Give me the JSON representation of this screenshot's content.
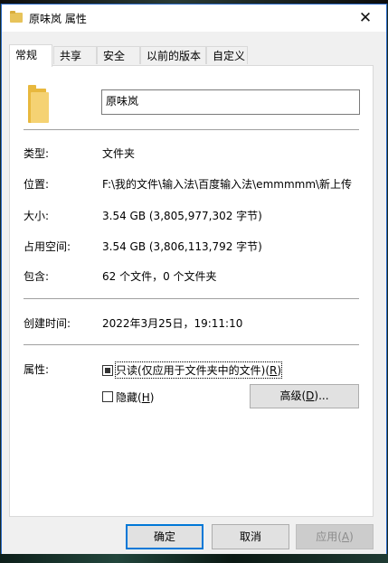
{
  "window": {
    "title": "原味岚 属性",
    "close_glyph": "✕"
  },
  "tabs": [
    "常规",
    "共享",
    "安全",
    "以前的版本",
    "自定义"
  ],
  "active_tab": "常规",
  "general": {
    "name_value": "原味岚",
    "rows": [
      {
        "label": "类型:",
        "value": "文件夹"
      },
      {
        "label": "位置:",
        "value": "F:\\我的文件\\输入法\\百度输入法\\emmmmm\\新上传"
      },
      {
        "label": "大小:",
        "value": "3.54 GB (3,805,977,302 字节)"
      },
      {
        "label": "占用空间:",
        "value": "3.54 GB (3,806,113,792 字节)"
      },
      {
        "label": "包含:",
        "value": "62 个文件，0 个文件夹"
      }
    ],
    "created": {
      "label": "创建时间:",
      "value": "2022年3月25日，19:11:10"
    },
    "attributes": {
      "label": "属性:",
      "readonly_text": "只读(仅应用于文件夹中的文件)(",
      "readonly_key": "R",
      "readonly_close": ")",
      "readonly_state": "indeterminate",
      "hidden_text": "隐藏(",
      "hidden_key": "H",
      "hidden_close": ")",
      "hidden_state": "unchecked",
      "advanced_text": "高级(",
      "advanced_key": "D",
      "advanced_close": ")..."
    }
  },
  "buttons": {
    "ok": "确定",
    "cancel": "取消",
    "apply_text": "应用(",
    "apply_key": "A",
    "apply_close": ")"
  },
  "colors": {
    "folder": "#e8b83e",
    "accent": "#0078d7"
  }
}
